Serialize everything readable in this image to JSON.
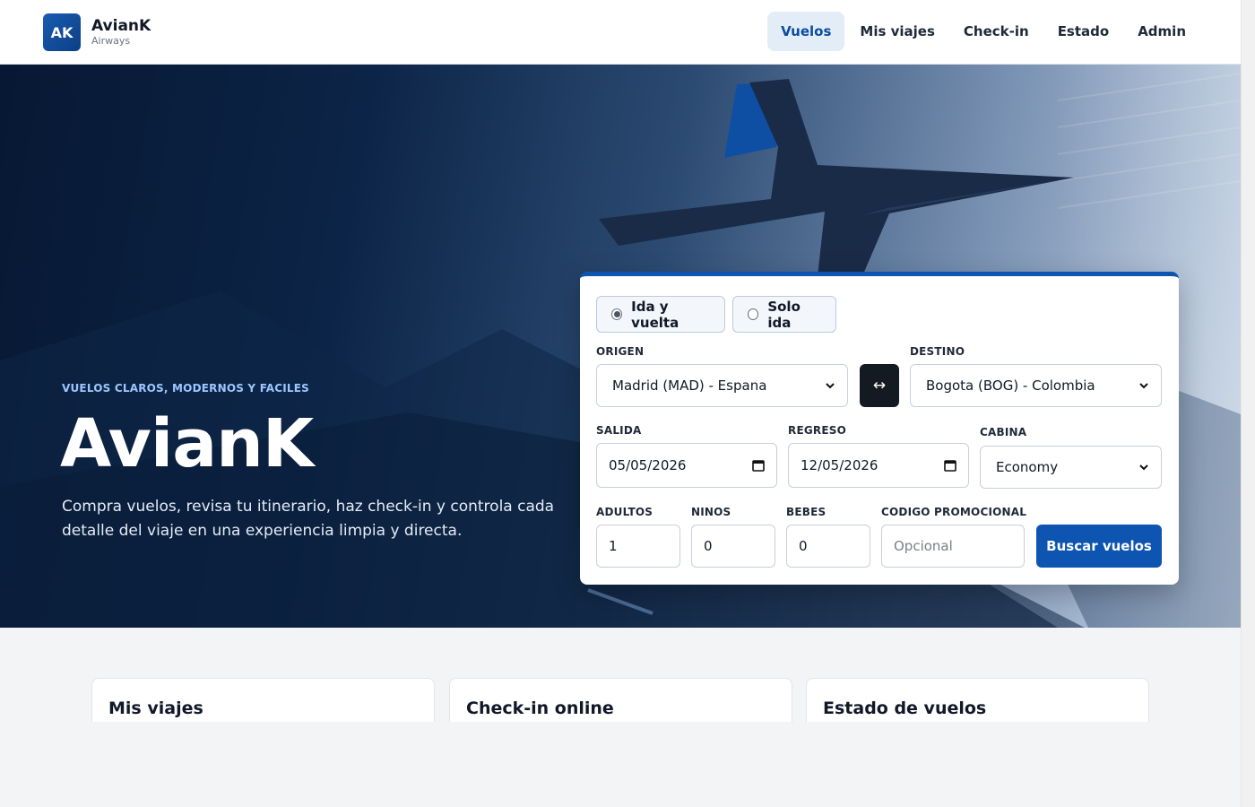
{
  "brand": {
    "mark": "AK",
    "name": "AvianK",
    "sub": "Airways"
  },
  "nav": [
    {
      "label": "Vuelos",
      "active": true
    },
    {
      "label": "Mis viajes",
      "active": false
    },
    {
      "label": "Check-in",
      "active": false
    },
    {
      "label": "Estado",
      "active": false
    },
    {
      "label": "Admin",
      "active": false
    }
  ],
  "hero": {
    "eyebrow": "VUELOS CLAROS, MODERNOS Y FACILES",
    "title": "AvianK",
    "description": "Compra vuelos, revisa tu itinerario, haz check-in y controla cada detalle del viaje en una experiencia limpia y directa."
  },
  "search": {
    "trip_types": [
      {
        "label": "Ida y vuelta",
        "selected": true
      },
      {
        "label": "Solo ida",
        "selected": false
      }
    ],
    "origin": {
      "label": "ORIGEN",
      "value": "Madrid (MAD) - Espana"
    },
    "swap_symbol": "↔",
    "destination": {
      "label": "DESTINO",
      "value": "Bogota (BOG) - Colombia"
    },
    "departure": {
      "label": "SALIDA",
      "value": "05/05/2026"
    },
    "return": {
      "label": "REGRESO",
      "value": "12/05/2026"
    },
    "cabin": {
      "label": "CABINA",
      "value": "Economy"
    },
    "adults": {
      "label": "ADULTOS",
      "value": "1"
    },
    "children": {
      "label": "NINOS",
      "value": "0"
    },
    "infants": {
      "label": "BEBES",
      "value": "0"
    },
    "promo": {
      "label": "CODIGO PROMOCIONAL",
      "placeholder": "Opcional"
    },
    "submit_label": "Buscar vuelos"
  },
  "features": [
    {
      "title": "Mis viajes"
    },
    {
      "title": "Check-in online"
    },
    {
      "title": "Estado de vuelos"
    }
  ],
  "colors": {
    "primary": "#0d55b0",
    "nav_active_bg": "#e3edf8",
    "hero_dark": "#071833"
  }
}
